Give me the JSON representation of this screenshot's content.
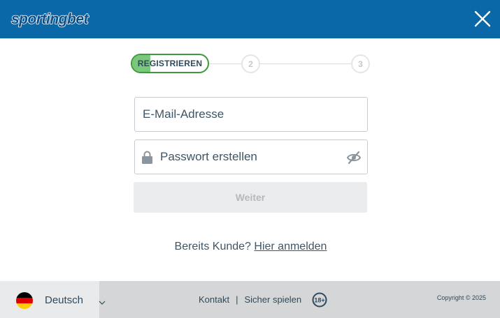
{
  "header": {
    "logo_text": "sportingbet",
    "brand_color": "#0a67a8",
    "close_icon": "close-icon"
  },
  "stepper": {
    "steps": [
      {
        "label": "REGISTRIEREN",
        "state": "active",
        "progress": 0.24
      },
      {
        "label": "2",
        "state": "inactive"
      },
      {
        "label": "3",
        "state": "inactive"
      }
    ],
    "active_color": "#3c9a3c"
  },
  "form": {
    "email_placeholder": "E-Mail-Adresse",
    "email_value": "",
    "password_placeholder": "Passwort erstellen",
    "password_value": "",
    "lock_icon": "lock-icon",
    "visibility_icon": "eye-off-icon",
    "continue_label": "Weiter"
  },
  "login": {
    "prompt": "Bereits Kunde?",
    "link": "Hier anmelden"
  },
  "footer": {
    "language": "Deutsch",
    "flag_icon": "germany-flag-icon",
    "contact": "Kontakt",
    "separator": "|",
    "responsible": "Sicher spielen",
    "age_badge": "18+",
    "copyright": "Copyright © 2025"
  }
}
